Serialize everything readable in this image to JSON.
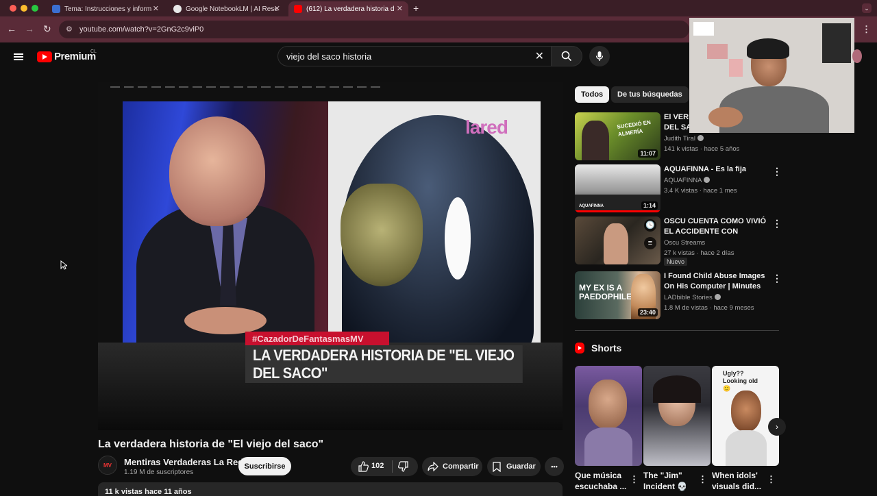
{
  "browser": {
    "tabs": [
      {
        "label": "Tema: Instrucciones y inform",
        "favicon_color": "#3b6fd1"
      },
      {
        "label": "Google NotebookLM | AI Rese",
        "favicon_color": "#e8e8e8"
      },
      {
        "label": "(612) La verdadera historia d",
        "favicon_color": "#ff0000"
      }
    ],
    "new_tab": "+",
    "url": "youtube.com/watch?v=2GnG2c9viP0"
  },
  "youtube": {
    "logo_text": "Premium",
    "country": "CL",
    "search_value": "viejo del saco historia",
    "video": {
      "overlay_hashtag": "#CazadorDeFantasmasMV",
      "overlay_banner": "LA VERDADERA HISTORIA DE \"EL VIEJO DEL SACO\"",
      "overlay_logo": "lared",
      "title": "La verdadera historia de \"El viejo del saco\"",
      "channel": "Mentiras Verdaderas La Red",
      "channel_avatar": "MV",
      "subscribers": "1.19 M de suscriptores",
      "subscribe_label": "Suscribirse",
      "likes": "102",
      "share_label": "Compartir",
      "save_label": "Guardar",
      "more": "•••",
      "description_meta": "11 k vistas  hace 11 años"
    },
    "chips": [
      "Todos",
      "De tus búsquedas"
    ],
    "related": [
      {
        "title": "El VERDADERO HOMBRE DEL SACO",
        "channel": "Judith Tiral",
        "meta": "141 k vistas · hace 5 años",
        "duration": "11:07",
        "thumb_text": "SUCEDIÓ EN ALMERÍA"
      },
      {
        "title": "AQUAFINNA - Es la fija",
        "channel": "AQUAFINNA",
        "meta": "3.4 K vistas · hace 1 mes",
        "duration": "1:14",
        "thumb_text": "AQUAFINNA"
      },
      {
        "title": "OSCU CUENTA COMO VIVIÓ EL ACCIDENTE CON BRUNENGER",
        "channel": "Oscu Streams",
        "meta": "27 k vistas · hace 2 días",
        "badge": "Nuevo"
      },
      {
        "title": "I Found Child Abuse Images On His Computer | Minutes With",
        "channel": "LADbible Stories",
        "meta": "1.8 M de vistas · hace 9 meses",
        "duration": "23:40",
        "thumb_text": "MY EX IS A PAEDOPHILE"
      }
    ],
    "shorts": {
      "heading": "Shorts",
      "items": [
        {
          "title": "Que música escuchaba ..."
        },
        {
          "title": "The \"Jim\" Incident 💀"
        },
        {
          "title": "When idols' visuals did...",
          "thumb_text": "Ugly?? Looking old🙂"
        }
      ]
    }
  },
  "colors": {
    "accent": "#ff0000",
    "bg": "#0f0f0f",
    "browser": "#5a2b38"
  }
}
